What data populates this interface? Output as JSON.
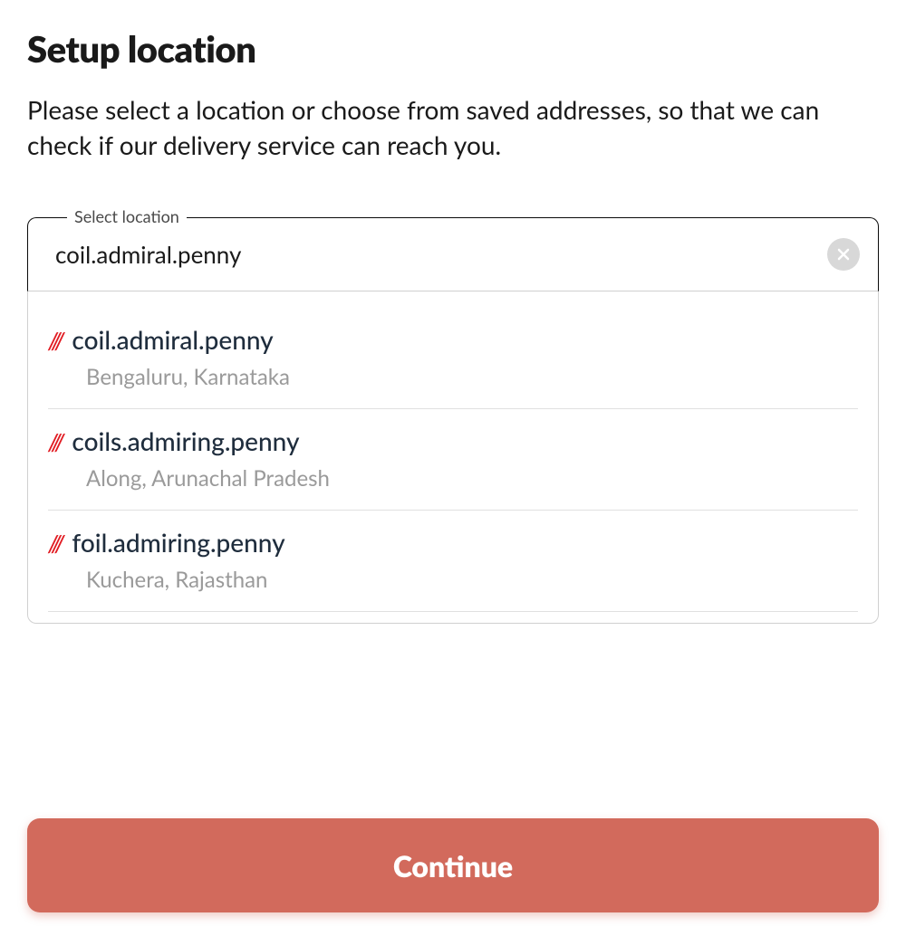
{
  "header": {
    "title": "Setup location",
    "subtitle": "Please select a location or choose from saved addresses, so that we can check if our delivery service can reach you."
  },
  "field": {
    "label": "Select location",
    "value": "coil.admiral.penny"
  },
  "suggestions": [
    {
      "slashes": "///",
      "words": "coil.admiral.penny",
      "location": "Bengaluru, Karnataka"
    },
    {
      "slashes": "///",
      "words": "coils.admiring.penny",
      "location": "Along, Arunachal Pradesh"
    },
    {
      "slashes": "///",
      "words": "foil.admiring.penny",
      "location": "Kuchera, Rajasthan"
    }
  ],
  "actions": {
    "continue": "Continue"
  }
}
